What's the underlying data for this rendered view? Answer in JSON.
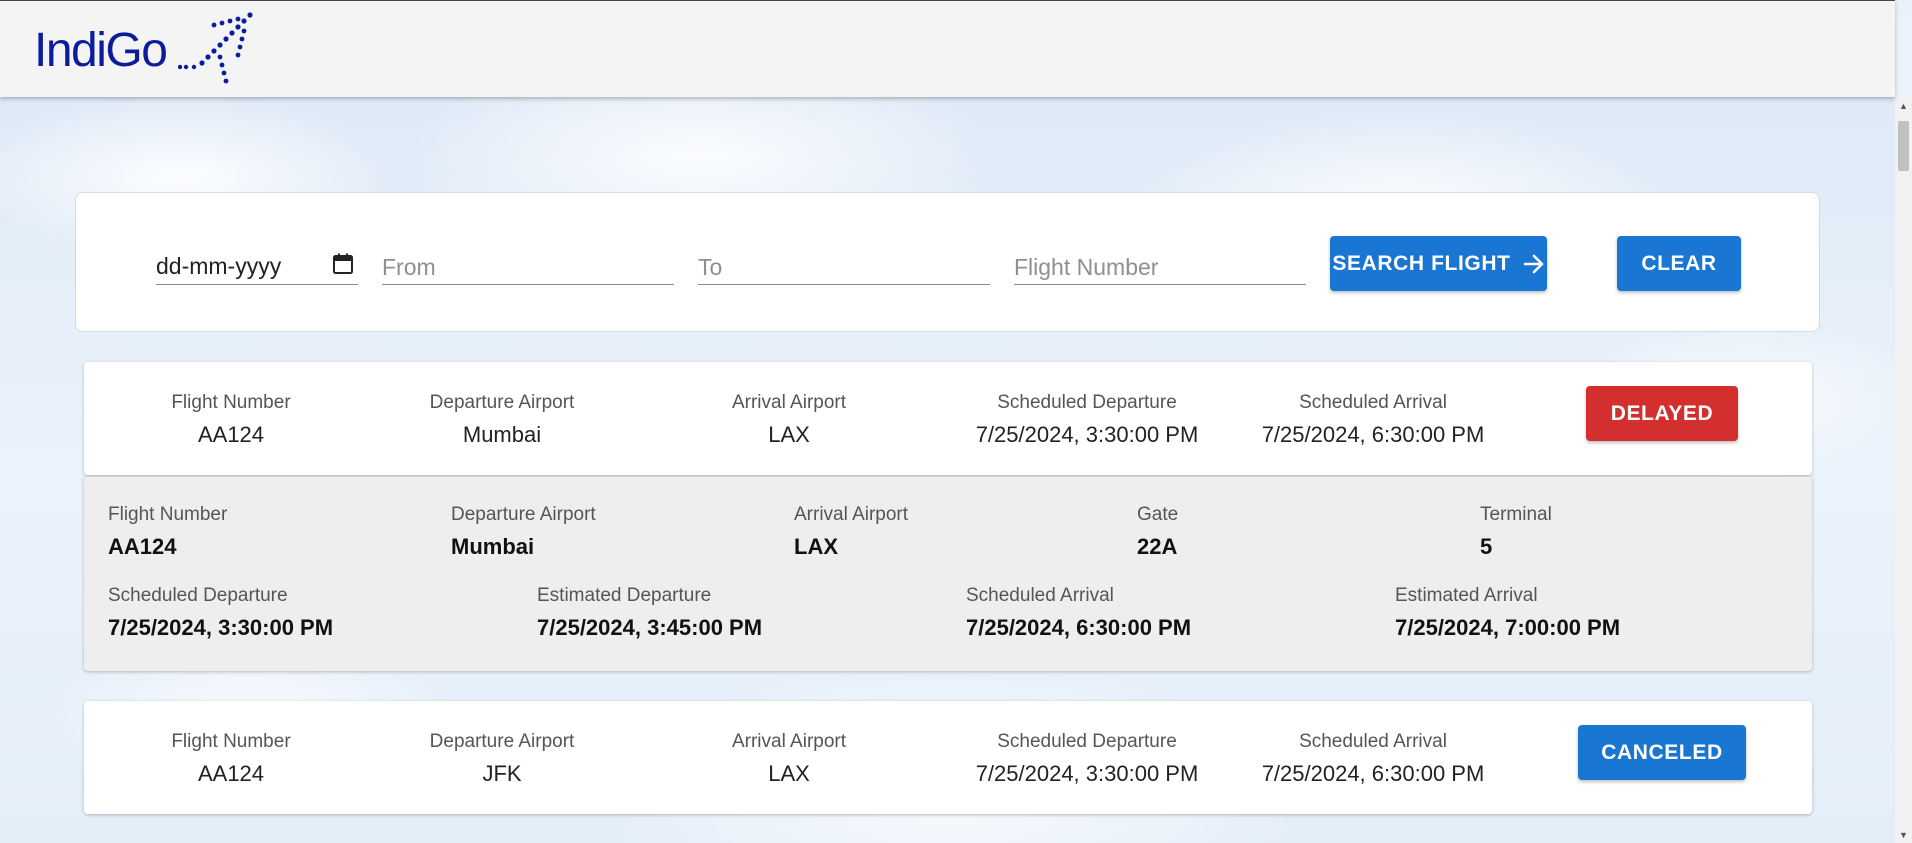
{
  "header": {
    "logo_text": "IndiGo",
    "logo_icon": "indigo-dotted-plane-icon",
    "brand_color": "#0b1c9c"
  },
  "search": {
    "date_value": "dd-mm-yyyy",
    "from_placeholder": "From",
    "to_placeholder": "To",
    "flight_number_placeholder": "Flight Number",
    "search_label": "SEARCH FLIGHT",
    "clear_label": "CLEAR",
    "button_color": "#1976d2"
  },
  "flights": [
    {
      "summary": {
        "flight_number_label": "Flight Number",
        "flight_number": "AA124",
        "departure_airport_label": "Departure Airport",
        "departure_airport": "Mumbai",
        "arrival_airport_label": "Arrival Airport",
        "arrival_airport": "LAX",
        "scheduled_departure_label": "Scheduled Departure",
        "scheduled_departure": "7/25/2024, 3:30:00 PM",
        "scheduled_arrival_label": "Scheduled Arrival",
        "scheduled_arrival": "7/25/2024, 6:30:00 PM",
        "status": "DELAYED",
        "status_color": "#d32f2f"
      },
      "details": {
        "flight_number_label": "Flight Number",
        "flight_number": "AA124",
        "departure_airport_label": "Departure Airport",
        "departure_airport": "Mumbai",
        "arrival_airport_label": "Arrival Airport",
        "arrival_airport": "LAX",
        "gate_label": "Gate",
        "gate": "22A",
        "terminal_label": "Terminal",
        "terminal": "5",
        "scheduled_departure_label": "Scheduled Departure",
        "scheduled_departure": "7/25/2024, 3:30:00 PM",
        "estimated_departure_label": "Estimated Departure",
        "estimated_departure": "7/25/2024, 3:45:00 PM",
        "scheduled_arrival_label": "Scheduled Arrival",
        "scheduled_arrival": "7/25/2024, 6:30:00 PM",
        "estimated_arrival_label": "Estimated Arrival",
        "estimated_arrival": "7/25/2024, 7:00:00 PM"
      }
    },
    {
      "summary": {
        "flight_number_label": "Flight Number",
        "flight_number": "AA124",
        "departure_airport_label": "Departure Airport",
        "departure_airport": "JFK",
        "arrival_airport_label": "Arrival Airport",
        "arrival_airport": "LAX",
        "scheduled_departure_label": "Scheduled Departure",
        "scheduled_departure": "7/25/2024, 3:30:00 PM",
        "scheduled_arrival_label": "Scheduled Arrival",
        "scheduled_arrival": "7/25/2024, 6:30:00 PM",
        "status": "CANCELED",
        "status_color": "#1976d2"
      }
    }
  ]
}
